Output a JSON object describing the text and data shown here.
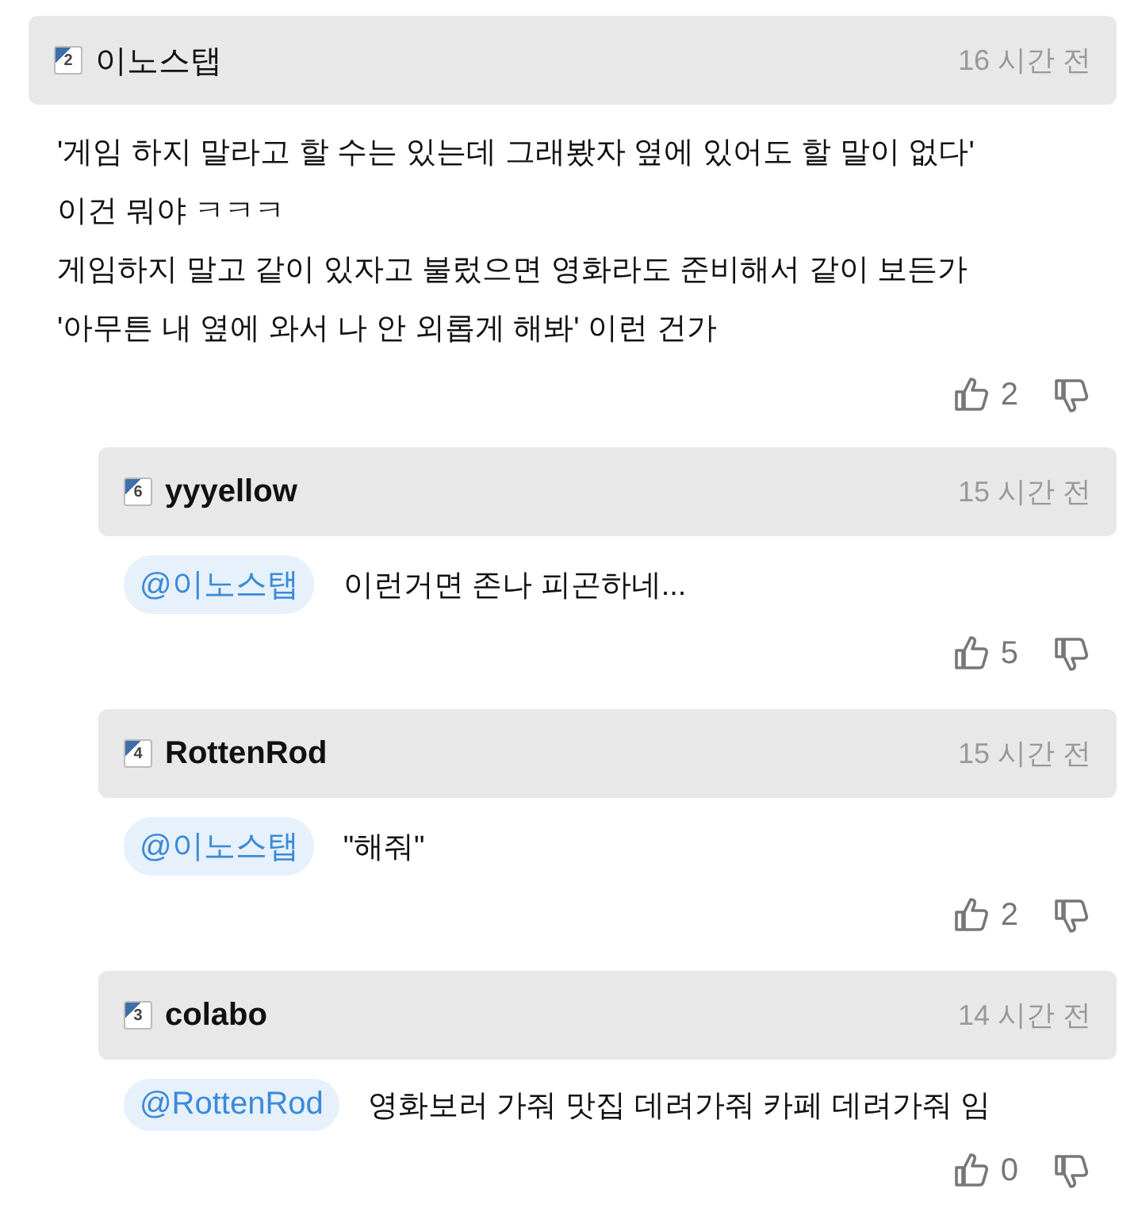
{
  "comment": {
    "level": "2",
    "author": "이노스탭",
    "time": "16 시간 전",
    "lines": [
      "'게임 하지 말라고 할 수는 있는데 그래봤자 옆에 있어도 할 말이 없다'",
      "이건 뭐야 ㅋㅋㅋ",
      "게임하지 말고 같이 있자고 불렀으면 영화라도 준비해서 같이 보든가",
      "'아무튼 내 옆에 와서 나 안 외롭게 해봐' 이런 건가"
    ],
    "likes": "2"
  },
  "replies": [
    {
      "level": "6",
      "author": "yyyellow",
      "time": "15 시간 전",
      "mention": "@이노스탭",
      "text": "이런거면 존나 피곤하네...",
      "likes": "5"
    },
    {
      "level": "4",
      "author": "RottenRod",
      "time": "15 시간 전",
      "mention": "@이노스탭",
      "text": "\"해줘\"",
      "likes": "2"
    },
    {
      "level": "3",
      "author": "colabo",
      "time": "14 시간 전",
      "mention": "@RottenRod",
      "text": "영화보러 가줘 맛집 데려가줘 카페 데려가줘 임",
      "likes": "0"
    }
  ]
}
